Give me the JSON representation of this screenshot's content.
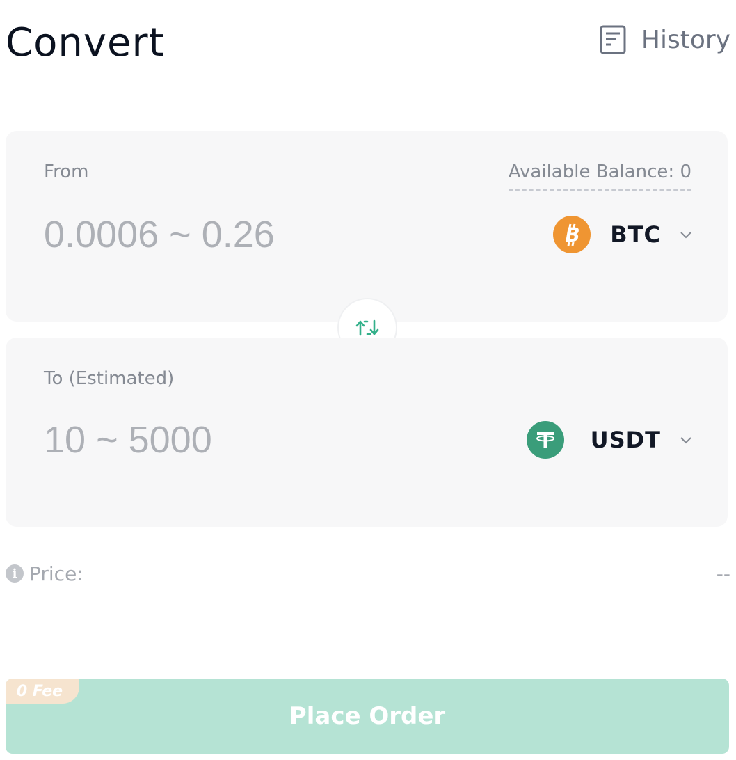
{
  "header": {
    "title": "Convert",
    "history_label": "History",
    "history_icon": "document-list-icon"
  },
  "from": {
    "label": "From",
    "available_balance": "Available Balance: 0",
    "placeholder": "0.0006 ~ 0.26",
    "coin": "BTC",
    "coin_icon": "bitcoin-icon",
    "coin_color": "#ef9532"
  },
  "swap": {
    "icon": "swap-arrows-icon",
    "color": "#33b08a"
  },
  "to": {
    "label": "To (Estimated)",
    "placeholder": "10 ~ 5000",
    "coin": "USDT",
    "coin_icon": "tether-icon",
    "coin_color": "#3a9d7a"
  },
  "price": {
    "label": "Price:",
    "value": "--"
  },
  "order": {
    "button_label": "Place Order",
    "fee_badge": "0 Fee",
    "button_color": "#b5e3d4"
  }
}
